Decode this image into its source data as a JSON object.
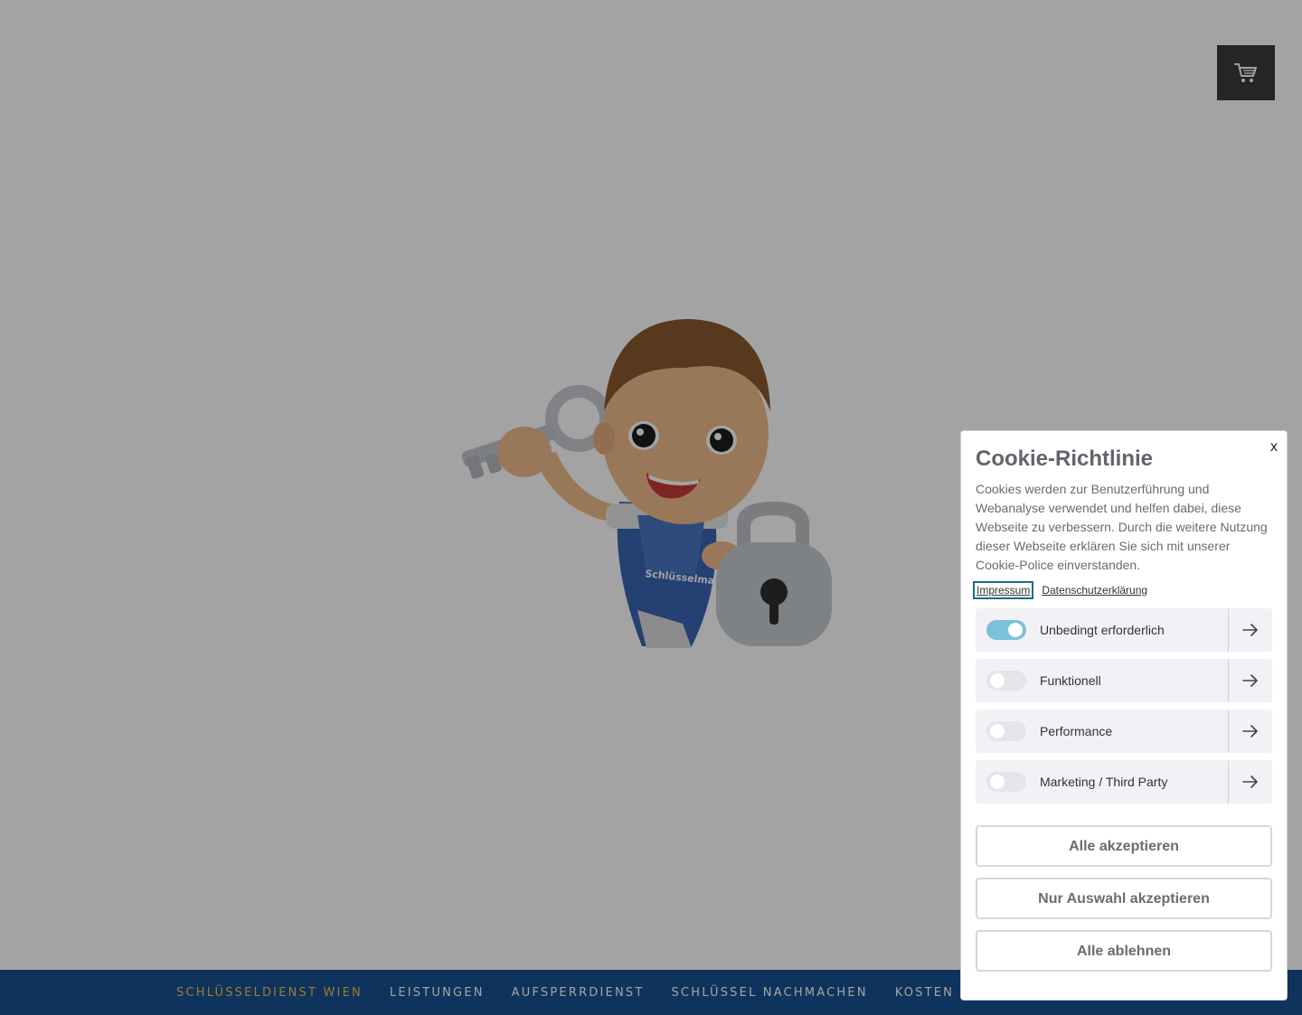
{
  "header": {
    "cart_icon": "shopping-cart-icon"
  },
  "mascot": {
    "badge_text": "Schlüsselmax"
  },
  "nav": {
    "items": [
      {
        "label": "SCHLÜSSELDIENST WIEN",
        "active": true
      },
      {
        "label": "LEISTUNGEN"
      },
      {
        "label": "AUFSPERRDIENST"
      },
      {
        "label": "SCHLÜSSEL NACHMACHEN"
      },
      {
        "label": "KOSTEN & PREISE"
      }
    ],
    "background": "#175090",
    "active_color": "#f2c14e"
  },
  "cookie": {
    "close": "x",
    "title": "Cookie-Richtlinie",
    "text": "Cookies werden zur Benutzerführung und Webanalyse verwendet und helfen dabei, diese Webseite zu verbessern. Durch die weitere Nutzung dieser Webseite erklären Sie sich mit unserer Cookie-Police einverstanden.",
    "links": {
      "impressum": "Impressum",
      "datenschutz": "Datenschutzerklärung"
    },
    "categories": [
      {
        "label": "Unbedingt erforderlich",
        "enabled": true
      },
      {
        "label": "Funktionell",
        "enabled": false
      },
      {
        "label": "Performance",
        "enabled": false
      },
      {
        "label": "Marketing / Third Party",
        "enabled": false
      }
    ],
    "buttons": {
      "accept_all": "Alle akzeptieren",
      "accept_selection": "Nur Auswahl akzeptieren",
      "reject_all": "Alle ablehnen"
    },
    "toggle_on_color": "#7cc0d9"
  }
}
